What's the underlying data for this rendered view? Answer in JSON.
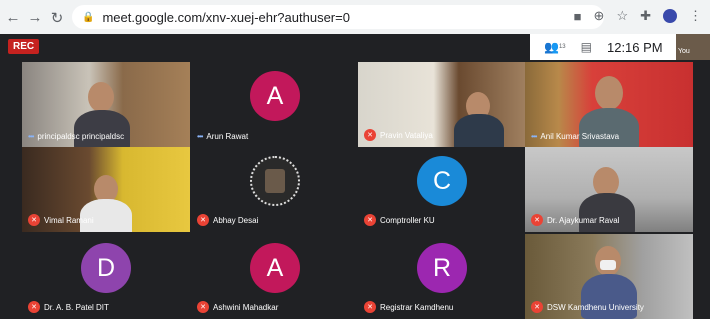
{
  "browser": {
    "url": "meet.google.com/xnv-xuej-ehr?authuser=0",
    "icons": [
      "back-icon",
      "forward-icon",
      "reload-icon",
      "lock-icon",
      "camera-icon",
      "zoom-icon",
      "star-icon",
      "extension-icon",
      "profile-icon",
      "menu-icon"
    ]
  },
  "meeting": {
    "rec_label": "REC",
    "participants_count": "13",
    "time": "12:16 PM",
    "self_label": "You"
  },
  "tiles": [
    {
      "name": "principaldsc principaldsc",
      "mic": "speaking",
      "type": "video"
    },
    {
      "name": "Arun Rawat",
      "mic": "speaking",
      "type": "avatar",
      "letter": "A",
      "color": "#c2185b"
    },
    {
      "name": "Pravin Vataliya",
      "mic": "muted",
      "type": "video"
    },
    {
      "name": "Anil Kumar Srivastava",
      "mic": "speaking",
      "type": "video"
    },
    {
      "name": "Vimal Ramani",
      "mic": "muted",
      "type": "video"
    },
    {
      "name": "Abhay Desai",
      "mic": "muted",
      "type": "avatar-image"
    },
    {
      "name": "Comptroller KU",
      "mic": "muted",
      "type": "avatar",
      "letter": "C",
      "color": "#1a8ad8"
    },
    {
      "name": "Dr. Ajaykumar Raval",
      "mic": "muted",
      "type": "video"
    },
    {
      "name": "Dr. A. B. Patel DIT",
      "mic": "muted",
      "type": "avatar",
      "letter": "D",
      "color": "#8e44ad"
    },
    {
      "name": "Ashwini Mahadkar",
      "mic": "muted",
      "type": "avatar",
      "letter": "A",
      "color": "#c2185b"
    },
    {
      "name": "Registrar Kamdhenu",
      "mic": "muted",
      "type": "avatar",
      "letter": "R",
      "color": "#9c27b0"
    },
    {
      "name": "DSW Kamdhenu University",
      "mic": "muted",
      "type": "video"
    }
  ]
}
